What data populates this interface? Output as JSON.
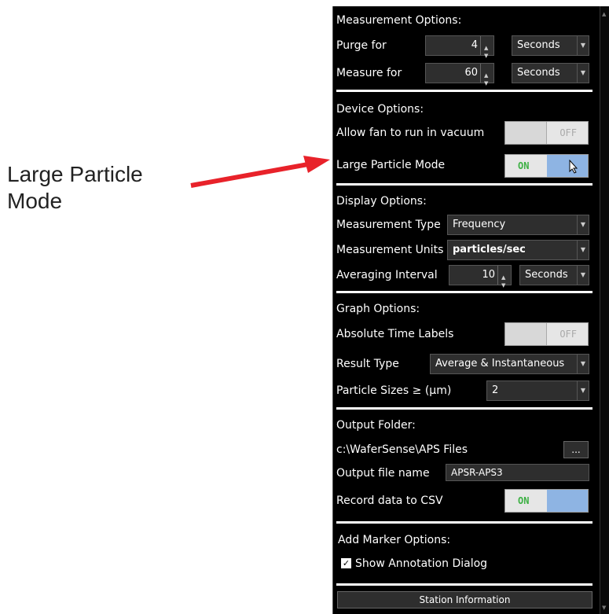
{
  "callout": {
    "text": "Large Particle Mode"
  },
  "measurement": {
    "heading": "Measurement Options:",
    "purge_label": "Purge for",
    "purge_value": "4",
    "purge_unit": "Seconds",
    "measure_label": "Measure for",
    "measure_value": "60",
    "measure_unit": "Seconds"
  },
  "device": {
    "heading": "Device Options:",
    "fan_label": "Allow fan to run in vacuum",
    "fan_state": "OFF",
    "lpm_label": "Large Particle Mode",
    "lpm_state": "ON"
  },
  "display": {
    "heading": "Display Options:",
    "type_label": "Measurement Type",
    "type_value": "Frequency",
    "units_label": "Measurement Units",
    "units_value": "particles/sec",
    "avg_label": "Averaging Interval",
    "avg_value": "10",
    "avg_unit": "Seconds"
  },
  "graph": {
    "heading": "Graph Options:",
    "abs_label": "Absolute Time Labels",
    "abs_state": "OFF",
    "result_label": "Result Type",
    "result_value": "Average & Instantaneous",
    "sizes_label": "Particle Sizes ≥ (µm)",
    "sizes_value": "2"
  },
  "output": {
    "heading": "Output Folder:",
    "folder_path": "c:\\WaferSense\\APS Files",
    "browse_label": "...",
    "filename_label": "Output file name",
    "filename_value": "APSR-APS3",
    "csv_label": "Record data to CSV",
    "csv_state": "ON"
  },
  "marker": {
    "heading": "Add Marker Options:",
    "annotation_label": "Show Annotation Dialog",
    "annotation_checked": true
  },
  "station_button": "Station Information",
  "colors": {
    "panel_bg": "#000000",
    "toggle_on_text": "#3cb043",
    "toggle_knob_on": "#8eb4e3",
    "arrow": "#e8222a"
  }
}
